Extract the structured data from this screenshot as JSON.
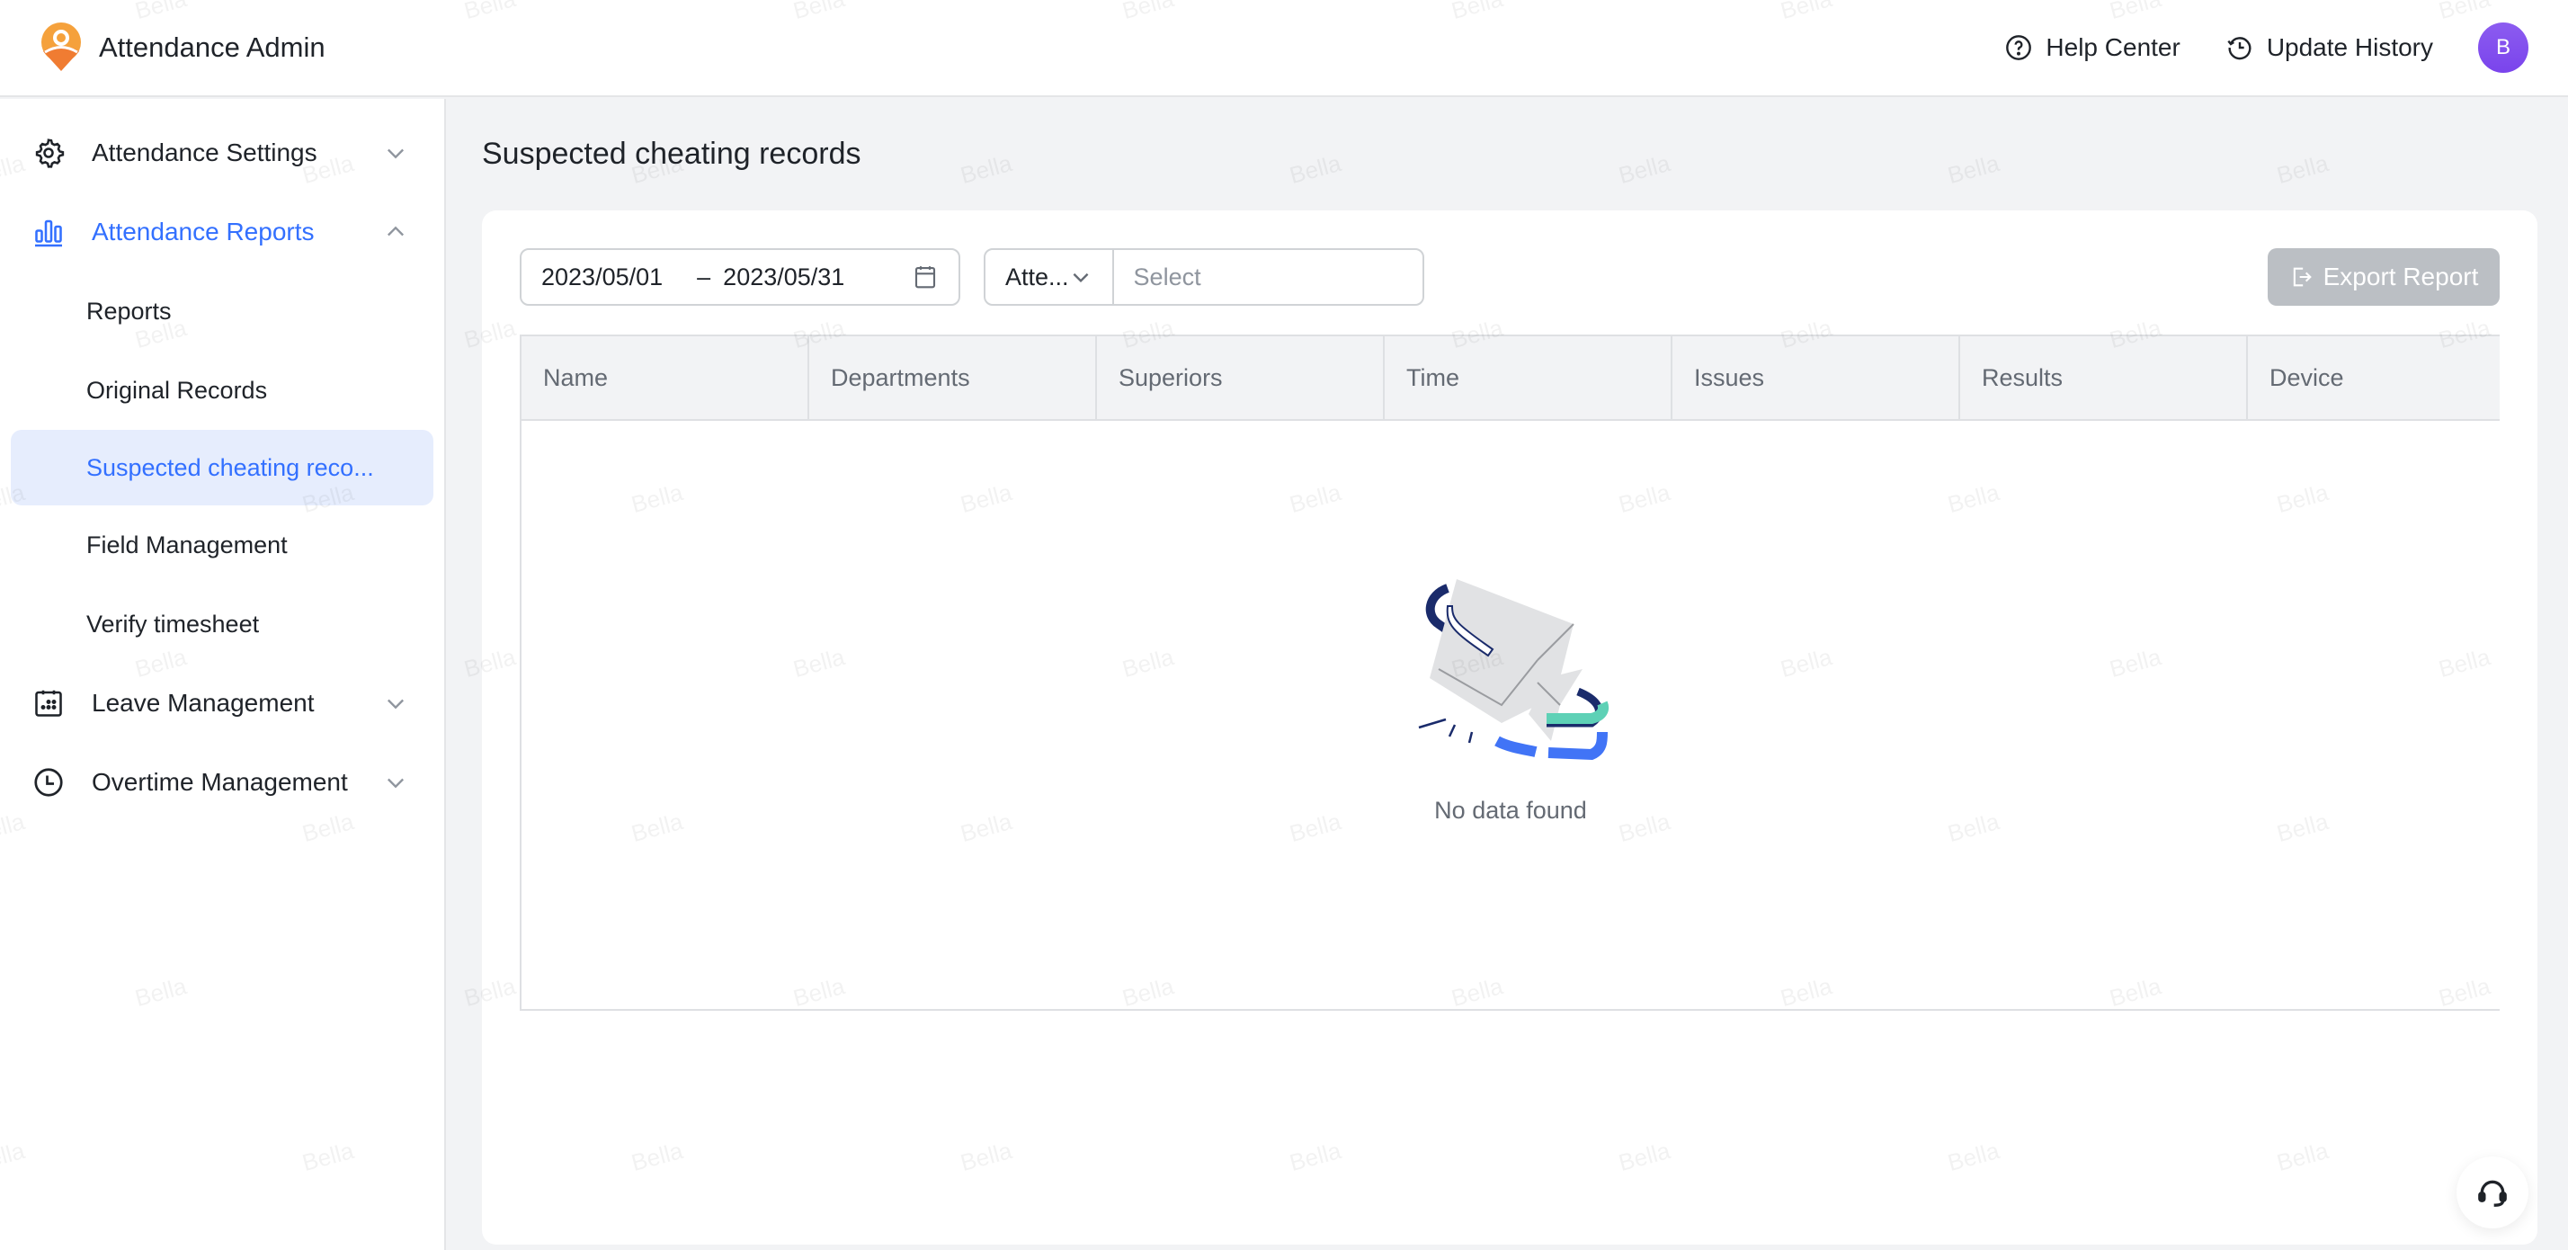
{
  "header": {
    "app_title": "Attendance Admin",
    "help_center": "Help Center",
    "update_history": "Update History",
    "avatar_initial": "B"
  },
  "sidebar": {
    "groups": [
      {
        "label": "Attendance Settings",
        "icon": "gear-icon",
        "expanded": false,
        "active": false
      },
      {
        "label": "Attendance Reports",
        "icon": "bar-chart-icon",
        "expanded": true,
        "active": true
      },
      {
        "label": "Leave Management",
        "icon": "calendar-icon",
        "expanded": false,
        "active": false
      },
      {
        "label": "Overtime Management",
        "icon": "clock-icon",
        "expanded": false,
        "active": false
      }
    ],
    "report_items": [
      {
        "label": "Reports",
        "selected": false
      },
      {
        "label": "Original Records",
        "selected": false
      },
      {
        "label": "Suspected cheating reco...",
        "selected": true
      },
      {
        "label": "Field Management",
        "selected": false
      },
      {
        "label": "Verify timesheet",
        "selected": false
      }
    ]
  },
  "main": {
    "page_title": "Suspected cheating records",
    "filters": {
      "date_start": "2023/05/01",
      "date_separator": "–",
      "date_end": "2023/05/31",
      "type_select_value": "Atte...",
      "search_placeholder": "Select"
    },
    "export_button": "Export Report",
    "table": {
      "columns": [
        "Name",
        "Departments",
        "Superiors",
        "Time",
        "Issues",
        "Results",
        "Device"
      ],
      "rows": [],
      "empty_text": "No data found"
    }
  },
  "watermark_text": "Bella",
  "colors": {
    "accent": "#3370ff",
    "selected_bg": "#e6edfd",
    "avatar": "#7a44ec",
    "brand_orange": "#f5a13c",
    "export_disabled": "#bbbfc4"
  }
}
